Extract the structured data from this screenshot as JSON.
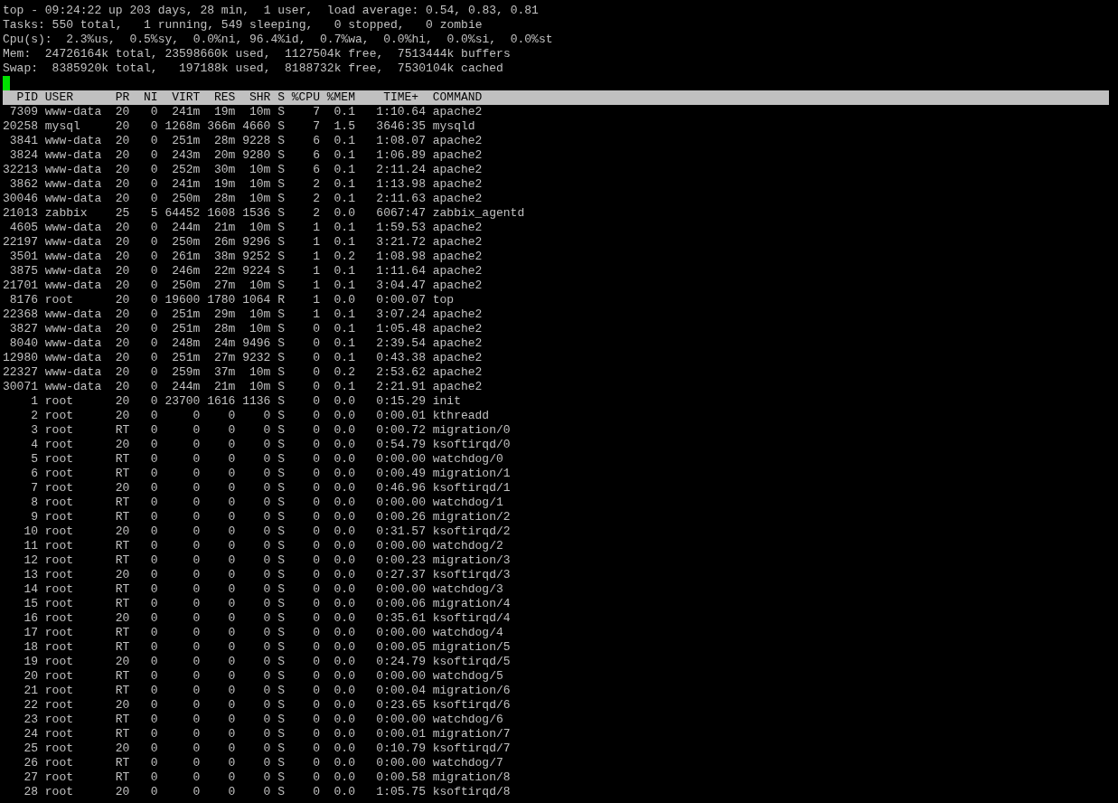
{
  "summary": [
    "top - 09:24:22 up 203 days, 28 min,  1 user,  load average: 0.54, 0.83, 0.81",
    "Tasks: 550 total,   1 running, 549 sleeping,   0 stopped,   0 zombie",
    "Cpu(s):  2.3%us,  0.5%sy,  0.0%ni, 96.4%id,  0.7%wa,  0.0%hi,  0.0%si,  0.0%st",
    "Mem:  24726164k total, 23598660k used,  1127504k free,  7513444k buffers",
    "Swap:  8385920k total,   197188k used,  8188732k free,  7530104k cached"
  ],
  "table": {
    "columns": [
      "PID",
      "USER",
      "PR",
      "NI",
      "VIRT",
      "RES",
      "SHR",
      "S",
      "%CPU",
      "%MEM",
      "TIME+",
      "COMMAND"
    ],
    "rows": [
      [
        "7309",
        "www-data",
        "20",
        "0",
        "241m",
        "19m",
        "10m",
        "S",
        "7",
        "0.1",
        "1:10.64",
        "apache2"
      ],
      [
        "20258",
        "mysql",
        "20",
        "0",
        "1268m",
        "366m",
        "4660",
        "S",
        "7",
        "1.5",
        "3646:35",
        "mysqld"
      ],
      [
        "3841",
        "www-data",
        "20",
        "0",
        "251m",
        "28m",
        "9228",
        "S",
        "6",
        "0.1",
        "1:08.07",
        "apache2"
      ],
      [
        "3824",
        "www-data",
        "20",
        "0",
        "243m",
        "20m",
        "9280",
        "S",
        "6",
        "0.1",
        "1:06.89",
        "apache2"
      ],
      [
        "32213",
        "www-data",
        "20",
        "0",
        "252m",
        "30m",
        "10m",
        "S",
        "6",
        "0.1",
        "2:11.24",
        "apache2"
      ],
      [
        "3862",
        "www-data",
        "20",
        "0",
        "241m",
        "19m",
        "10m",
        "S",
        "2",
        "0.1",
        "1:13.98",
        "apache2"
      ],
      [
        "30046",
        "www-data",
        "20",
        "0",
        "250m",
        "28m",
        "10m",
        "S",
        "2",
        "0.1",
        "2:11.63",
        "apache2"
      ],
      [
        "21013",
        "zabbix",
        "25",
        "5",
        "64452",
        "1608",
        "1536",
        "S",
        "2",
        "0.0",
        "6067:47",
        "zabbix_agentd"
      ],
      [
        "4605",
        "www-data",
        "20",
        "0",
        "244m",
        "21m",
        "10m",
        "S",
        "1",
        "0.1",
        "1:59.53",
        "apache2"
      ],
      [
        "22197",
        "www-data",
        "20",
        "0",
        "250m",
        "26m",
        "9296",
        "S",
        "1",
        "0.1",
        "3:21.72",
        "apache2"
      ],
      [
        "3501",
        "www-data",
        "20",
        "0",
        "261m",
        "38m",
        "9252",
        "S",
        "1",
        "0.2",
        "1:08.98",
        "apache2"
      ],
      [
        "3875",
        "www-data",
        "20",
        "0",
        "246m",
        "22m",
        "9224",
        "S",
        "1",
        "0.1",
        "1:11.64",
        "apache2"
      ],
      [
        "21701",
        "www-data",
        "20",
        "0",
        "250m",
        "27m",
        "10m",
        "S",
        "1",
        "0.1",
        "3:04.47",
        "apache2"
      ],
      [
        "8176",
        "root",
        "20",
        "0",
        "19600",
        "1780",
        "1064",
        "R",
        "1",
        "0.0",
        "0:00.07",
        "top"
      ],
      [
        "22368",
        "www-data",
        "20",
        "0",
        "251m",
        "29m",
        "10m",
        "S",
        "1",
        "0.1",
        "3:07.24",
        "apache2"
      ],
      [
        "3827",
        "www-data",
        "20",
        "0",
        "251m",
        "28m",
        "10m",
        "S",
        "0",
        "0.1",
        "1:05.48",
        "apache2"
      ],
      [
        "8040",
        "www-data",
        "20",
        "0",
        "248m",
        "24m",
        "9496",
        "S",
        "0",
        "0.1",
        "2:39.54",
        "apache2"
      ],
      [
        "12980",
        "www-data",
        "20",
        "0",
        "251m",
        "27m",
        "9232",
        "S",
        "0",
        "0.1",
        "0:43.38",
        "apache2"
      ],
      [
        "22327",
        "www-data",
        "20",
        "0",
        "259m",
        "37m",
        "10m",
        "S",
        "0",
        "0.2",
        "2:53.62",
        "apache2"
      ],
      [
        "30071",
        "www-data",
        "20",
        "0",
        "244m",
        "21m",
        "10m",
        "S",
        "0",
        "0.1",
        "2:21.91",
        "apache2"
      ],
      [
        "1",
        "root",
        "20",
        "0",
        "23700",
        "1616",
        "1136",
        "S",
        "0",
        "0.0",
        "0:15.29",
        "init"
      ],
      [
        "2",
        "root",
        "20",
        "0",
        "0",
        "0",
        "0",
        "S",
        "0",
        "0.0",
        "0:00.01",
        "kthreadd"
      ],
      [
        "3",
        "root",
        "RT",
        "0",
        "0",
        "0",
        "0",
        "S",
        "0",
        "0.0",
        "0:00.72",
        "migration/0"
      ],
      [
        "4",
        "root",
        "20",
        "0",
        "0",
        "0",
        "0",
        "S",
        "0",
        "0.0",
        "0:54.79",
        "ksoftirqd/0"
      ],
      [
        "5",
        "root",
        "RT",
        "0",
        "0",
        "0",
        "0",
        "S",
        "0",
        "0.0",
        "0:00.00",
        "watchdog/0"
      ],
      [
        "6",
        "root",
        "RT",
        "0",
        "0",
        "0",
        "0",
        "S",
        "0",
        "0.0",
        "0:00.49",
        "migration/1"
      ],
      [
        "7",
        "root",
        "20",
        "0",
        "0",
        "0",
        "0",
        "S",
        "0",
        "0.0",
        "0:46.96",
        "ksoftirqd/1"
      ],
      [
        "8",
        "root",
        "RT",
        "0",
        "0",
        "0",
        "0",
        "S",
        "0",
        "0.0",
        "0:00.00",
        "watchdog/1"
      ],
      [
        "9",
        "root",
        "RT",
        "0",
        "0",
        "0",
        "0",
        "S",
        "0",
        "0.0",
        "0:00.26",
        "migration/2"
      ],
      [
        "10",
        "root",
        "20",
        "0",
        "0",
        "0",
        "0",
        "S",
        "0",
        "0.0",
        "0:31.57",
        "ksoftirqd/2"
      ],
      [
        "11",
        "root",
        "RT",
        "0",
        "0",
        "0",
        "0",
        "S",
        "0",
        "0.0",
        "0:00.00",
        "watchdog/2"
      ],
      [
        "12",
        "root",
        "RT",
        "0",
        "0",
        "0",
        "0",
        "S",
        "0",
        "0.0",
        "0:00.23",
        "migration/3"
      ],
      [
        "13",
        "root",
        "20",
        "0",
        "0",
        "0",
        "0",
        "S",
        "0",
        "0.0",
        "0:27.37",
        "ksoftirqd/3"
      ],
      [
        "14",
        "root",
        "RT",
        "0",
        "0",
        "0",
        "0",
        "S",
        "0",
        "0.0",
        "0:00.00",
        "watchdog/3"
      ],
      [
        "15",
        "root",
        "RT",
        "0",
        "0",
        "0",
        "0",
        "S",
        "0",
        "0.0",
        "0:00.06",
        "migration/4"
      ],
      [
        "16",
        "root",
        "20",
        "0",
        "0",
        "0",
        "0",
        "S",
        "0",
        "0.0",
        "0:35.61",
        "ksoftirqd/4"
      ],
      [
        "17",
        "root",
        "RT",
        "0",
        "0",
        "0",
        "0",
        "S",
        "0",
        "0.0",
        "0:00.00",
        "watchdog/4"
      ],
      [
        "18",
        "root",
        "RT",
        "0",
        "0",
        "0",
        "0",
        "S",
        "0",
        "0.0",
        "0:00.05",
        "migration/5"
      ],
      [
        "19",
        "root",
        "20",
        "0",
        "0",
        "0",
        "0",
        "S",
        "0",
        "0.0",
        "0:24.79",
        "ksoftirqd/5"
      ],
      [
        "20",
        "root",
        "RT",
        "0",
        "0",
        "0",
        "0",
        "S",
        "0",
        "0.0",
        "0:00.00",
        "watchdog/5"
      ],
      [
        "21",
        "root",
        "RT",
        "0",
        "0",
        "0",
        "0",
        "S",
        "0",
        "0.0",
        "0:00.04",
        "migration/6"
      ],
      [
        "22",
        "root",
        "20",
        "0",
        "0",
        "0",
        "0",
        "S",
        "0",
        "0.0",
        "0:23.65",
        "ksoftirqd/6"
      ],
      [
        "23",
        "root",
        "RT",
        "0",
        "0",
        "0",
        "0",
        "S",
        "0",
        "0.0",
        "0:00.00",
        "watchdog/6"
      ],
      [
        "24",
        "root",
        "RT",
        "0",
        "0",
        "0",
        "0",
        "S",
        "0",
        "0.0",
        "0:00.01",
        "migration/7"
      ],
      [
        "25",
        "root",
        "20",
        "0",
        "0",
        "0",
        "0",
        "S",
        "0",
        "0.0",
        "0:10.79",
        "ksoftirqd/7"
      ],
      [
        "26",
        "root",
        "RT",
        "0",
        "0",
        "0",
        "0",
        "S",
        "0",
        "0.0",
        "0:00.00",
        "watchdog/7"
      ],
      [
        "27",
        "root",
        "RT",
        "0",
        "0",
        "0",
        "0",
        "S",
        "0",
        "0.0",
        "0:00.58",
        "migration/8"
      ],
      [
        "28",
        "root",
        "20",
        "0",
        "0",
        "0",
        "0",
        "S",
        "0",
        "0.0",
        "1:05.75",
        "ksoftirqd/8"
      ]
    ]
  }
}
